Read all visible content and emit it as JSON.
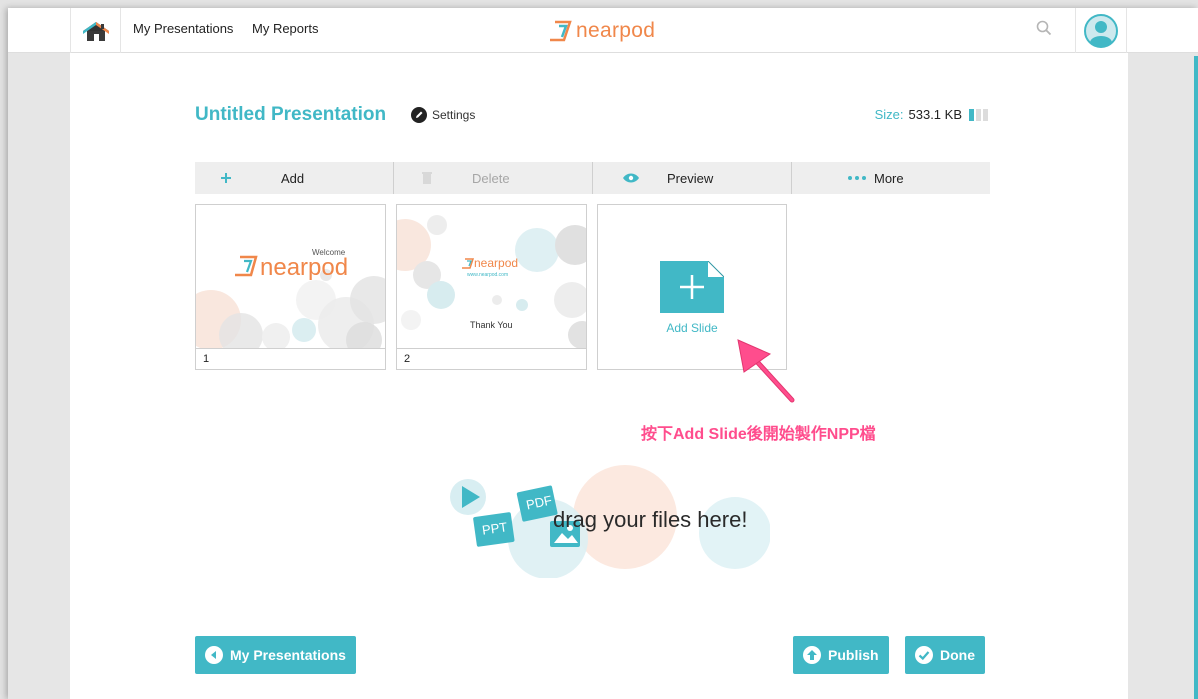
{
  "nav": {
    "links": [
      "My Presentations",
      "My Reports"
    ],
    "brand": "nearpod"
  },
  "presentation": {
    "title": "Untitled Presentation",
    "settings_label": "Settings",
    "size_label": "Size:",
    "size_value": "533.1 KB",
    "size_meter_filled_fraction": 0.33
  },
  "toolbar": {
    "add": "Add",
    "delete": "Delete",
    "preview": "Preview",
    "more": "More"
  },
  "slides": [
    {
      "number": "1",
      "caption": "Welcome",
      "brand": "nearpod"
    },
    {
      "number": "2",
      "brand": "nearpod",
      "url": "www.nearpod.com",
      "caption": "Thank You"
    }
  ],
  "add_slide_label": "Add Slide",
  "annotation": "按下Add Slide後開始製作NPP檔",
  "dropzone": {
    "text": "drag your files here!",
    "badges": [
      "PPT",
      "PDF"
    ]
  },
  "buttons": {
    "back": "My Presentations",
    "publish": "Publish",
    "done": "Done"
  },
  "colors": {
    "accent": "#41b8c6",
    "brand_orange": "#f0874a",
    "annotation_pink": "#ff4d8d"
  },
  "icons": {
    "home": "home-icon",
    "search": "search-icon",
    "avatar": "user-avatar-icon",
    "settings": "pencil-icon",
    "add": "plus-icon",
    "delete": "trash-icon",
    "preview": "eye-icon",
    "more": "dots-icon"
  }
}
